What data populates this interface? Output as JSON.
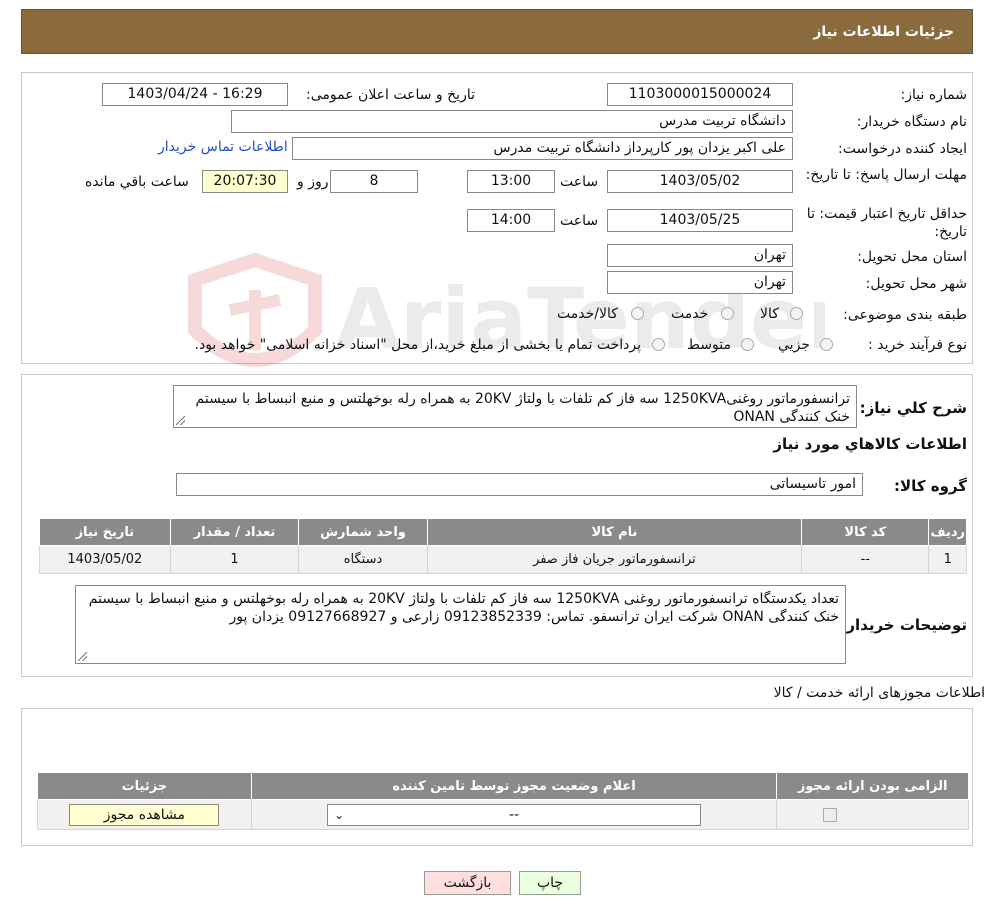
{
  "header": {
    "title": "جزئیات اطلاعات نیاز"
  },
  "details": {
    "need_number_label": "شماره نیاز:",
    "need_number": "1103000015000024",
    "announce_label": "تاریخ و ساعت اعلان عمومی:",
    "announce_value": "1403/04/24 - 16:29",
    "buyer_org_label": "نام دستگاه خریدار:",
    "buyer_org": "دانشگاه تربیت مدرس",
    "creator_label": "ایجاد کننده درخواست:",
    "creator": "علی اکبر یزدان پور کارپرداز دانشگاه تربیت مدرس",
    "contact_link": "اطلاعات تماس خریدار",
    "deadline_label": "مهلت ارسال پاسخ: تا تاریخ:",
    "deadline_date": "1403/05/02",
    "time_label": "ساعت",
    "deadline_time": "13:00",
    "days_value": "8",
    "days_label": "روز و",
    "remaining_time": "20:07:30",
    "remaining_label": "ساعت باقي مانده",
    "validity_label": "حداقل تاریخ اعتبار قیمت: تا تاریخ:",
    "validity_date": "1403/05/25",
    "validity_time": "14:00",
    "province_label": "استان محل تحویل:",
    "province": "تهران",
    "city_label": "شهر محل تحویل:",
    "city": "تهران",
    "category_label": "طبقه بندی موضوعی:",
    "category_options": [
      "کالا",
      "خدمت",
      "کالا/خدمت"
    ],
    "process_label": "نوع فرآیند خرید :",
    "process_options": [
      "جزیي",
      "متوسط"
    ],
    "process_note": "پرداخت تمام یا بخشی از مبلغ خرید،از محل \"اسناد خزانه اسلامی\" خواهد بود."
  },
  "summary": {
    "description_label": "شرح کلي نياز:",
    "description": "ترانسفورماتور روغنی1250KVA سه فاز کم تلفات با ولتاژ 20KV به همراه رله بوخهلتس و منبع انبساط با سیستم خنک کنندگی ONAN",
    "goods_heading": "اطلاعات کالاهاي مورد نياز",
    "group_label": "گروه کالا:",
    "group_value": "امور تاسیساتی",
    "table": {
      "headers": [
        "رديف",
        "کد کالا",
        "نام کالا",
        "واحد شمارش",
        "تعداد / مقدار",
        "تاریخ نیاز"
      ],
      "rows": [
        [
          "1",
          "--",
          "ترانسفورماتور جریان فاز صفر",
          "دستگاه",
          "1",
          "1403/05/02"
        ]
      ]
    },
    "buyer_notes_label": "توضيحات خريدار:",
    "buyer_notes": "تعداد یکدستگاه ترانسفورماتور روغنی 1250KVA سه فاز کم تلفات با ولتاژ 20KV  به همراه رله بوخهلتس و منبع انبساط با سیستم خنک کنندگی ONAN شرکت ایران ترانسفو. تماس: 09123852339 زارعی و 09127668927 یزدان پور"
  },
  "permits": {
    "heading": "اطلاعات مجوزهای ارائه خدمت / کالا",
    "headers": [
      "الزامی بودن ارائه مجوز",
      "اعلام وضعیت مجوز توسط تامین کننده",
      "جزئیات"
    ],
    "select_value": "--",
    "view_button": "مشاهده مجوز"
  },
  "actions": {
    "print": "چاپ",
    "back": "بازگشت"
  },
  "watermark": {
    "text": "AriaTender.neT"
  },
  "colors": {
    "header_bg": "#8b6b3d",
    "table_header": "#8a8a8a",
    "remaining_bg": "#ffffd0",
    "back_button_bg": "#ffdede",
    "print_button_bg": "#eaffdd"
  }
}
